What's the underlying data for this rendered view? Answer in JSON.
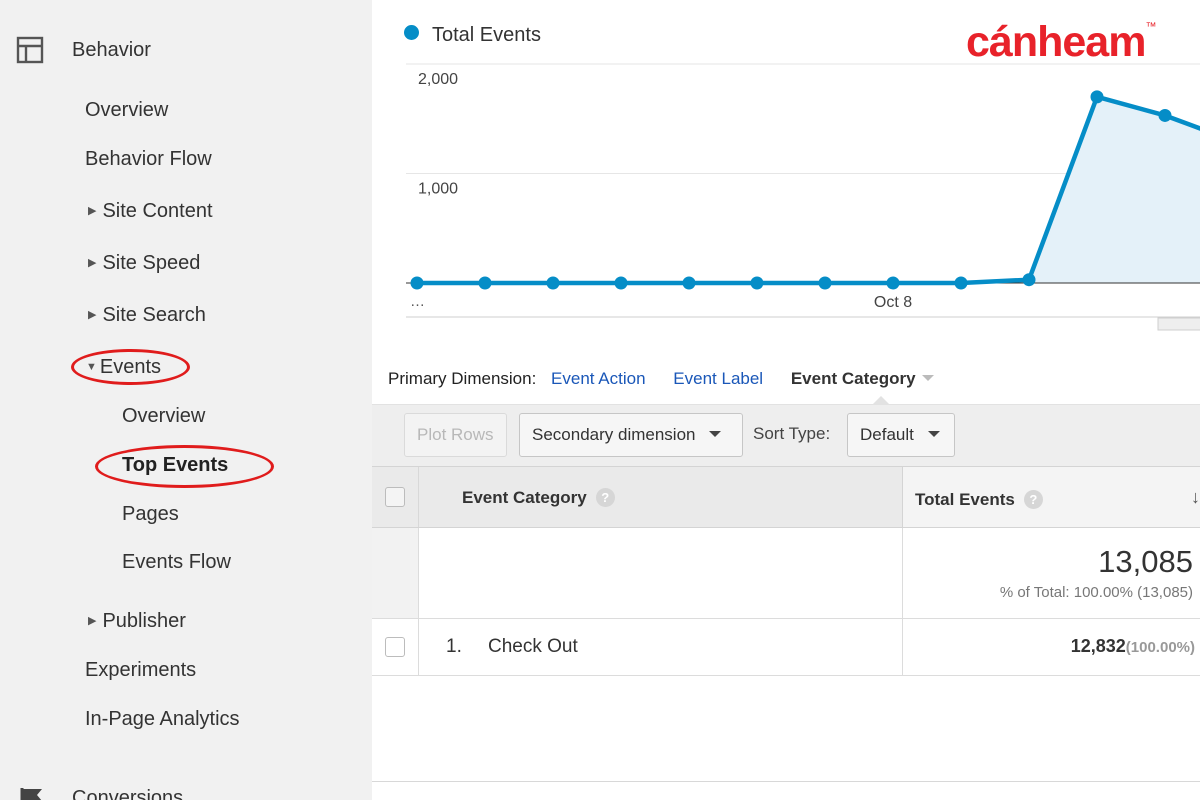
{
  "sidebar": {
    "section": "Behavior",
    "items": {
      "overview": "Overview",
      "behavior_flow": "Behavior Flow",
      "site_content": "Site Content",
      "site_speed": "Site Speed",
      "site_search": "Site Search",
      "events": "Events",
      "events_overview": "Overview",
      "top_events": "Top Events",
      "pages": "Pages",
      "events_flow": "Events Flow",
      "publisher": "Publisher",
      "experiments": "Experiments",
      "in_page_analytics": "In-Page Analytics"
    },
    "next_section": "Conversions",
    "highlight_color": "#e01c1c"
  },
  "brand": {
    "text": "cánheam",
    "tm": "™",
    "color": "#e8222a"
  },
  "chart_data": {
    "type": "line",
    "title": "",
    "legend": "Total Events",
    "xlabel": "",
    "ylabel": "",
    "x_tick_labels": [
      "…",
      "Oct 8"
    ],
    "y_ticks": [
      "2,000",
      "1,000"
    ],
    "ylim": [
      0,
      2000
    ],
    "series": [
      {
        "name": "Total Events",
        "color": "#058dc7",
        "fill": "#e4f1f9",
        "values": [
          0,
          0,
          0,
          0,
          0,
          0,
          0,
          0,
          0,
          30,
          1700,
          1530,
          1300
        ]
      }
    ]
  },
  "dimension_bar": {
    "label": "Primary Dimension:",
    "links": [
      "Event Action",
      "Event Label"
    ],
    "active": "Event Category"
  },
  "toolbar": {
    "plot_rows": "Plot Rows",
    "secondary_dimension": "Secondary dimension",
    "sort_type_label": "Sort Type:",
    "sort_type_value": "Default"
  },
  "table": {
    "columns": {
      "category": "Event Category",
      "total": "Total Events"
    },
    "help_glyph": "?",
    "sort_glyph": "↓",
    "summary": {
      "value": "13,085",
      "sub": "% of Total: 100.00% (13,085)"
    },
    "rows": [
      {
        "index": "1.",
        "category": "Check Out",
        "total": "12,832",
        "percent": "(100.00%)"
      }
    ]
  }
}
